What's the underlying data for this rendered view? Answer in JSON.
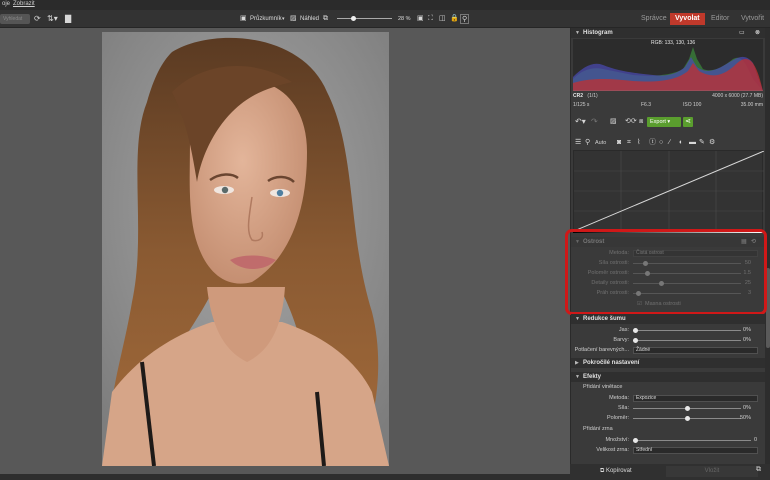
{
  "menu": {
    "items": [
      "oje",
      "Zobrazit"
    ]
  },
  "toolbar": {
    "search_value": "Vyhledat",
    "browser_label": "Průzkumník",
    "preview_label": "Náhled",
    "zoom_value": 28,
    "zoom_text": "28 %"
  },
  "tabs": [
    {
      "label": "Správce"
    },
    {
      "label": "Vyvolat",
      "active": true
    },
    {
      "label": "Editor"
    },
    {
      "label": "Vytvořit"
    }
  ],
  "histogram": {
    "title": "Histogram",
    "rgb_readout": "RGB: 133, 130, 136",
    "file_name": "CR2",
    "file_count": "(1/1)",
    "resolution": "4000 x 6000 (27.7 MB)",
    "shutter": "1/125 s",
    "aperture": "F6.3",
    "iso": "ISO 100",
    "focal": "35.00 mm"
  },
  "actions": {
    "export_label": "Export",
    "auto_label": "Auto"
  },
  "sharpen": {
    "title": "Ostrost",
    "method_label": "Metoda:",
    "method_value": "Čistá ostrost",
    "rows": [
      {
        "label": "Síla ostrosti:",
        "value": "50",
        "fraction": 0.1
      },
      {
        "label": "Poloměr ostrosti:",
        "value": "1.5",
        "fraction": 0.12
      },
      {
        "label": "Detaily ostrosti:",
        "value": "25",
        "fraction": 0.25
      },
      {
        "label": "Práh ostrosti:",
        "value": "3",
        "fraction": 0.03
      }
    ],
    "mask_label": "Masna ostrosti"
  },
  "noise": {
    "title": "Redukce šumu",
    "rows": [
      {
        "label": "Jas:",
        "value": "0%",
        "fraction": 0
      },
      {
        "label": "Barvy:",
        "value": "0%",
        "fraction": 0
      }
    ],
    "suppress_label": "Potlačení barevných...",
    "suppress_value": "Žádné"
  },
  "advanced": {
    "title": "Pokročilé nastavení"
  },
  "effects": {
    "title": "Efekty",
    "vignette_title": "Přidání vinětace",
    "method_label": "Metoda:",
    "method_value": "Expozice",
    "strength_label": "Síla:",
    "strength_value": "0%",
    "strength_fraction": 0.5,
    "radius_label": "Poloměr:",
    "radius_value": "50%",
    "radius_fraction": 0.5,
    "grain_title": "Přidání zrna",
    "amount_label": "Množství:",
    "amount_value": "0",
    "amount_fraction": 0,
    "size_label": "Velikost zrna:",
    "size_value": "Střední"
  },
  "bottom": {
    "copy_label": "Kopírovat",
    "paste_label": "Vložit"
  },
  "colors": {
    "accent": "#c0392b",
    "export_green": "#5a9e2e",
    "highlight": "#d01818"
  }
}
